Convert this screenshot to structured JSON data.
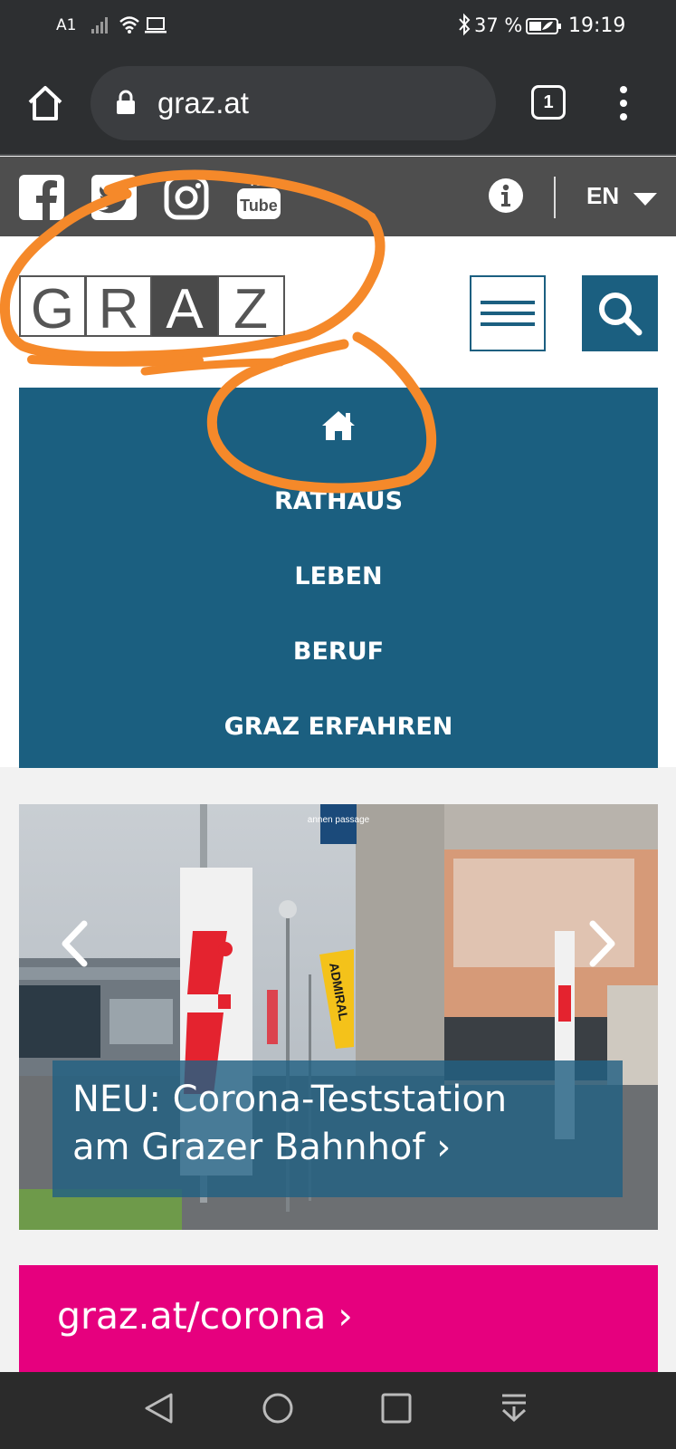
{
  "status_bar": {
    "carrier": "A1",
    "battery_percent": "37 %",
    "time": "19:19"
  },
  "browser": {
    "url": "graz.at",
    "tab_count": "1"
  },
  "top_strip": {
    "social_icons": [
      "facebook-icon",
      "twitter-icon",
      "instagram-icon",
      "youtube-icon"
    ],
    "language": "EN"
  },
  "header": {
    "logo_letters": [
      "G",
      "R",
      "A",
      "Z"
    ]
  },
  "nav": {
    "items": [
      "RATHAUS",
      "LEBEN",
      "BERUF",
      "GRAZ ERFAHREN"
    ]
  },
  "hero": {
    "caption_line1": "NEU: Corona-Teststation",
    "caption_line2": "am Grazer Bahnhof ›",
    "sign_text": "annen passage",
    "banner_text": "ADMIRAL"
  },
  "corona_banner": {
    "label": "graz.at/corona ›"
  },
  "colors": {
    "brand_blue": "#1b5f80",
    "corona_magenta": "#e6007e",
    "annotation_orange": "#f5892a"
  }
}
